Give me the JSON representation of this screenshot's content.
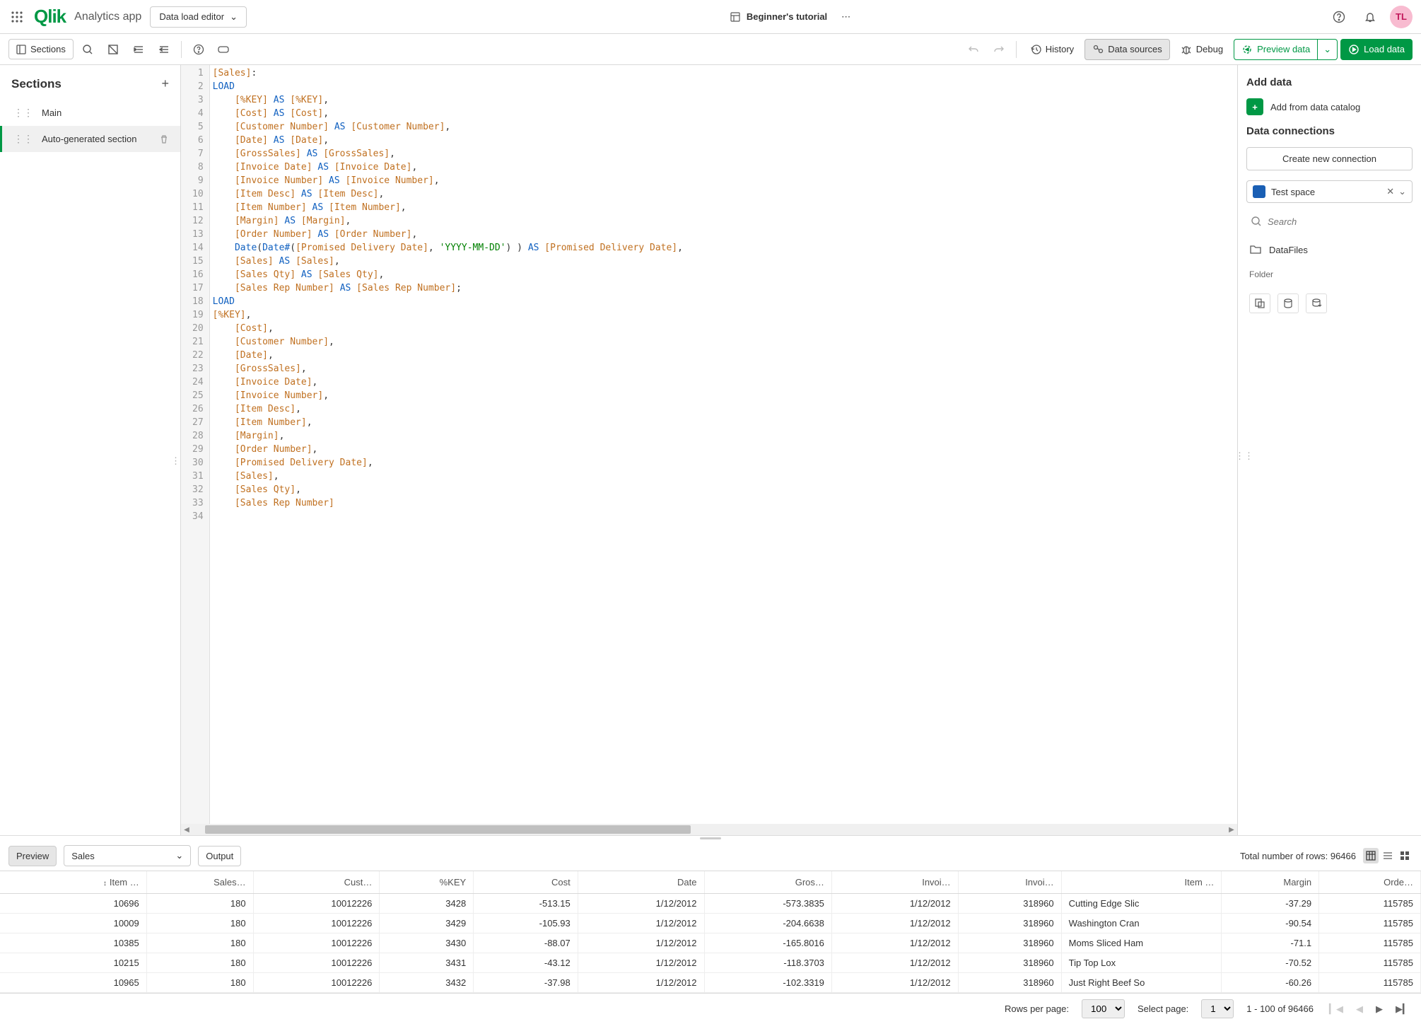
{
  "header": {
    "logo": "Qlik",
    "app_name": "Analytics app",
    "mode": "Data load editor",
    "tutorial": "Beginner's tutorial",
    "avatar": "TL"
  },
  "toolbar": {
    "sections": "Sections",
    "history": "History",
    "data_sources": "Data sources",
    "debug": "Debug",
    "preview": "Preview data",
    "load": "Load data"
  },
  "sidebar": {
    "title": "Sections",
    "items": [
      {
        "label": "Main",
        "active": false
      },
      {
        "label": "Auto-generated section",
        "active": true
      }
    ]
  },
  "code_lines": [
    [
      [
        "tk-field",
        "[Sales]"
      ],
      [
        "tk-plain",
        ":"
      ]
    ],
    [
      [
        "tk-kw",
        "LOAD"
      ]
    ],
    [
      [
        "tk-plain",
        "    "
      ],
      [
        "tk-field",
        "[%KEY]"
      ],
      [
        "tk-plain",
        " "
      ],
      [
        "tk-kw",
        "AS"
      ],
      [
        "tk-plain",
        " "
      ],
      [
        "tk-field",
        "[%KEY]"
      ],
      [
        "tk-plain",
        ","
      ]
    ],
    [
      [
        "tk-plain",
        "    "
      ],
      [
        "tk-field",
        "[Cost]"
      ],
      [
        "tk-plain",
        " "
      ],
      [
        "tk-kw",
        "AS"
      ],
      [
        "tk-plain",
        " "
      ],
      [
        "tk-field",
        "[Cost]"
      ],
      [
        "tk-plain",
        ","
      ]
    ],
    [
      [
        "tk-plain",
        "    "
      ],
      [
        "tk-field",
        "[Customer Number]"
      ],
      [
        "tk-plain",
        " "
      ],
      [
        "tk-kw",
        "AS"
      ],
      [
        "tk-plain",
        " "
      ],
      [
        "tk-field",
        "[Customer Number]"
      ],
      [
        "tk-plain",
        ","
      ]
    ],
    [
      [
        "tk-plain",
        "    "
      ],
      [
        "tk-field",
        "[Date]"
      ],
      [
        "tk-plain",
        " "
      ],
      [
        "tk-kw",
        "AS"
      ],
      [
        "tk-plain",
        " "
      ],
      [
        "tk-field",
        "[Date]"
      ],
      [
        "tk-plain",
        ","
      ]
    ],
    [
      [
        "tk-plain",
        "    "
      ],
      [
        "tk-field",
        "[GrossSales]"
      ],
      [
        "tk-plain",
        " "
      ],
      [
        "tk-kw",
        "AS"
      ],
      [
        "tk-plain",
        " "
      ],
      [
        "tk-field",
        "[GrossSales]"
      ],
      [
        "tk-plain",
        ","
      ]
    ],
    [
      [
        "tk-plain",
        "    "
      ],
      [
        "tk-field",
        "[Invoice Date]"
      ],
      [
        "tk-plain",
        " "
      ],
      [
        "tk-kw",
        "AS"
      ],
      [
        "tk-plain",
        " "
      ],
      [
        "tk-field",
        "[Invoice Date]"
      ],
      [
        "tk-plain",
        ","
      ]
    ],
    [
      [
        "tk-plain",
        "    "
      ],
      [
        "tk-field",
        "[Invoice Number]"
      ],
      [
        "tk-plain",
        " "
      ],
      [
        "tk-kw",
        "AS"
      ],
      [
        "tk-plain",
        " "
      ],
      [
        "tk-field",
        "[Invoice Number]"
      ],
      [
        "tk-plain",
        ","
      ]
    ],
    [
      [
        "tk-plain",
        "    "
      ],
      [
        "tk-field",
        "[Item Desc]"
      ],
      [
        "tk-plain",
        " "
      ],
      [
        "tk-kw",
        "AS"
      ],
      [
        "tk-plain",
        " "
      ],
      [
        "tk-field",
        "[Item Desc]"
      ],
      [
        "tk-plain",
        ","
      ]
    ],
    [
      [
        "tk-plain",
        "    "
      ],
      [
        "tk-field",
        "[Item Number]"
      ],
      [
        "tk-plain",
        " "
      ],
      [
        "tk-kw",
        "AS"
      ],
      [
        "tk-plain",
        " "
      ],
      [
        "tk-field",
        "[Item Number]"
      ],
      [
        "tk-plain",
        ","
      ]
    ],
    [
      [
        "tk-plain",
        "    "
      ],
      [
        "tk-field",
        "[Margin]"
      ],
      [
        "tk-plain",
        " "
      ],
      [
        "tk-kw",
        "AS"
      ],
      [
        "tk-plain",
        " "
      ],
      [
        "tk-field",
        "[Margin]"
      ],
      [
        "tk-plain",
        ","
      ]
    ],
    [
      [
        "tk-plain",
        "    "
      ],
      [
        "tk-field",
        "[Order Number]"
      ],
      [
        "tk-plain",
        " "
      ],
      [
        "tk-kw",
        "AS"
      ],
      [
        "tk-plain",
        " "
      ],
      [
        "tk-field",
        "[Order Number]"
      ],
      [
        "tk-plain",
        ","
      ]
    ],
    [
      [
        "tk-plain",
        "    "
      ],
      [
        "tk-func",
        "Date"
      ],
      [
        "tk-plain",
        "("
      ],
      [
        "tk-func",
        "Date#"
      ],
      [
        "tk-plain",
        "("
      ],
      [
        "tk-field",
        "[Promised Delivery Date]"
      ],
      [
        "tk-plain",
        ", "
      ],
      [
        "tk-str",
        "'YYYY-MM-DD'"
      ],
      [
        "tk-plain",
        ") ) "
      ],
      [
        "tk-kw",
        "AS"
      ],
      [
        "tk-plain",
        " "
      ],
      [
        "tk-field",
        "[Promised Delivery Date]"
      ],
      [
        "tk-plain",
        ","
      ]
    ],
    [
      [
        "tk-plain",
        "    "
      ],
      [
        "tk-field",
        "[Sales]"
      ],
      [
        "tk-plain",
        " "
      ],
      [
        "tk-kw",
        "AS"
      ],
      [
        "tk-plain",
        " "
      ],
      [
        "tk-field",
        "[Sales]"
      ],
      [
        "tk-plain",
        ","
      ]
    ],
    [
      [
        "tk-plain",
        "    "
      ],
      [
        "tk-field",
        "[Sales Qty]"
      ],
      [
        "tk-plain",
        " "
      ],
      [
        "tk-kw",
        "AS"
      ],
      [
        "tk-plain",
        " "
      ],
      [
        "tk-field",
        "[Sales Qty]"
      ],
      [
        "tk-plain",
        ","
      ]
    ],
    [
      [
        "tk-plain",
        "    "
      ],
      [
        "tk-field",
        "[Sales Rep Number]"
      ],
      [
        "tk-plain",
        " "
      ],
      [
        "tk-kw",
        "AS"
      ],
      [
        "tk-plain",
        " "
      ],
      [
        "tk-field",
        "[Sales Rep Number]"
      ],
      [
        "tk-plain",
        ";"
      ]
    ],
    [
      [
        "tk-kw",
        "LOAD"
      ]
    ],
    [
      [
        "tk-field",
        "[%KEY]"
      ],
      [
        "tk-plain",
        ","
      ]
    ],
    [
      [
        "tk-plain",
        "    "
      ],
      [
        "tk-field",
        "[Cost]"
      ],
      [
        "tk-plain",
        ","
      ]
    ],
    [
      [
        "tk-plain",
        "    "
      ],
      [
        "tk-field",
        "[Customer Number]"
      ],
      [
        "tk-plain",
        ","
      ]
    ],
    [
      [
        "tk-plain",
        "    "
      ],
      [
        "tk-field",
        "[Date]"
      ],
      [
        "tk-plain",
        ","
      ]
    ],
    [
      [
        "tk-plain",
        "    "
      ],
      [
        "tk-field",
        "[GrossSales]"
      ],
      [
        "tk-plain",
        ","
      ]
    ],
    [
      [
        "tk-plain",
        "    "
      ],
      [
        "tk-field",
        "[Invoice Date]"
      ],
      [
        "tk-plain",
        ","
      ]
    ],
    [
      [
        "tk-plain",
        "    "
      ],
      [
        "tk-field",
        "[Invoice Number]"
      ],
      [
        "tk-plain",
        ","
      ]
    ],
    [
      [
        "tk-plain",
        "    "
      ],
      [
        "tk-field",
        "[Item Desc]"
      ],
      [
        "tk-plain",
        ","
      ]
    ],
    [
      [
        "tk-plain",
        "    "
      ],
      [
        "tk-field",
        "[Item Number]"
      ],
      [
        "tk-plain",
        ","
      ]
    ],
    [
      [
        "tk-plain",
        "    "
      ],
      [
        "tk-field",
        "[Margin]"
      ],
      [
        "tk-plain",
        ","
      ]
    ],
    [
      [
        "tk-plain",
        "    "
      ],
      [
        "tk-field",
        "[Order Number]"
      ],
      [
        "tk-plain",
        ","
      ]
    ],
    [
      [
        "tk-plain",
        "    "
      ],
      [
        "tk-field",
        "[Promised Delivery Date]"
      ],
      [
        "tk-plain",
        ","
      ]
    ],
    [
      [
        "tk-plain",
        "    "
      ],
      [
        "tk-field",
        "[Sales]"
      ],
      [
        "tk-plain",
        ","
      ]
    ],
    [
      [
        "tk-plain",
        "    "
      ],
      [
        "tk-field",
        "[Sales Qty]"
      ],
      [
        "tk-plain",
        ","
      ]
    ],
    [
      [
        "tk-plain",
        "    "
      ],
      [
        "tk-field",
        "[Sales Rep Number]"
      ]
    ],
    [
      [
        "tk-plain",
        ""
      ]
    ]
  ],
  "right_panel": {
    "add_data": "Add data",
    "add_catalog": "Add from data catalog",
    "connections_title": "Data connections",
    "create_connection": "Create new connection",
    "space": "Test space",
    "search_placeholder": "Search",
    "datafiles": "DataFiles",
    "folder": "Folder"
  },
  "preview": {
    "preview_tab": "Preview",
    "output_tab": "Output",
    "table": "Sales",
    "total_rows": "Total number of rows: 96466",
    "columns": [
      "Item …",
      "Sales…",
      "Cust…",
      "%KEY",
      "Cost",
      "Date",
      "Gros…",
      "Invoi…",
      "Invoi…",
      "Item …",
      "Margin",
      "Orde…"
    ],
    "rows": [
      [
        "10696",
        "180",
        "10012226",
        "3428",
        "-513.15",
        "1/12/2012",
        "-573.3835",
        "1/12/2012",
        "318960",
        "Cutting Edge Slic",
        "-37.29",
        "115785"
      ],
      [
        "10009",
        "180",
        "10012226",
        "3429",
        "-105.93",
        "1/12/2012",
        "-204.6638",
        "1/12/2012",
        "318960",
        "Washington Cran",
        "-90.54",
        "115785"
      ],
      [
        "10385",
        "180",
        "10012226",
        "3430",
        "-88.07",
        "1/12/2012",
        "-165.8016",
        "1/12/2012",
        "318960",
        "Moms Sliced Ham",
        "-71.1",
        "115785"
      ],
      [
        "10215",
        "180",
        "10012226",
        "3431",
        "-43.12",
        "1/12/2012",
        "-118.3703",
        "1/12/2012",
        "318960",
        "Tip Top Lox",
        "-70.52",
        "115785"
      ],
      [
        "10965",
        "180",
        "10012226",
        "3432",
        "-37.98",
        "1/12/2012",
        "-102.3319",
        "1/12/2012",
        "318960",
        "Just Right Beef So",
        "-60.26",
        "115785"
      ]
    ]
  },
  "pager": {
    "rows_per_page_label": "Rows per page:",
    "rows_per_page": "100",
    "select_page_label": "Select page:",
    "select_page": "1",
    "range": "1 - 100 of 96466"
  }
}
